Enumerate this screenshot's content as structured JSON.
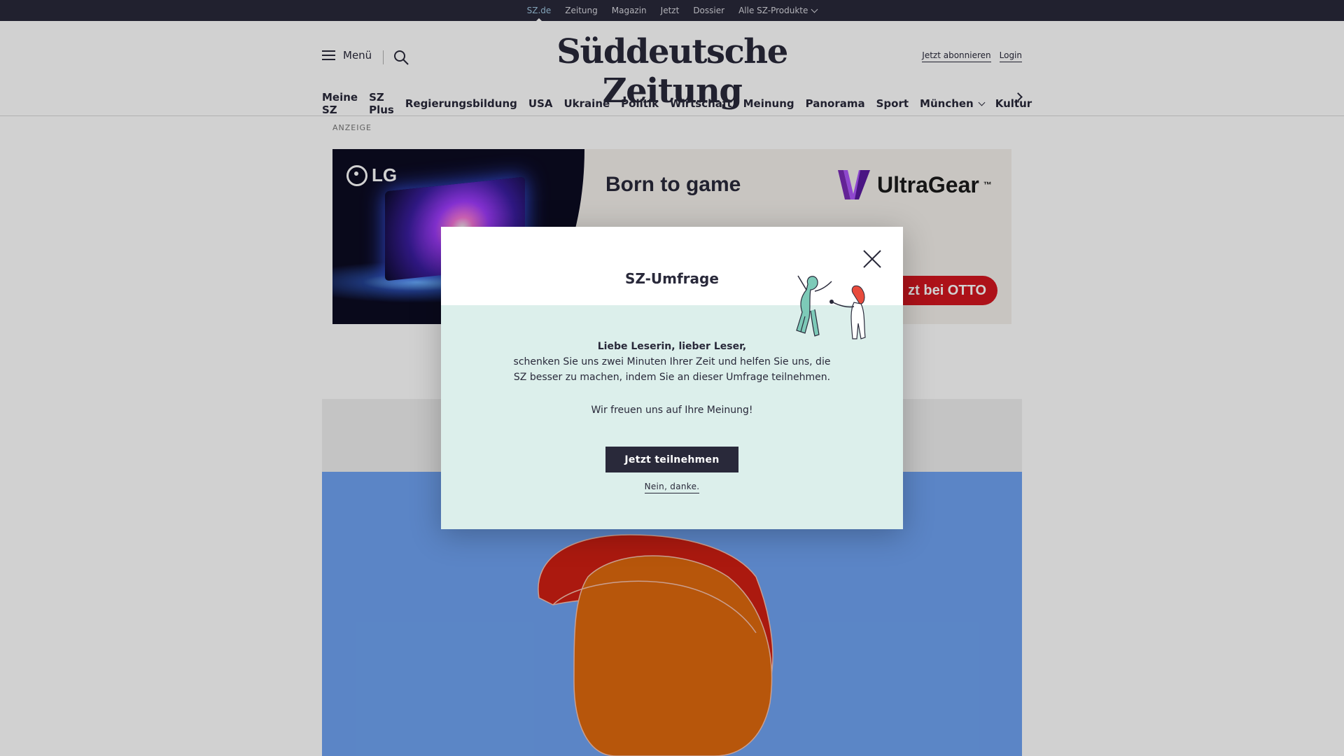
{
  "top_bar": {
    "items": [
      "SZ.de",
      "Zeitung",
      "Magazin",
      "Jetzt",
      "Dossier",
      "Alle SZ-Produkte"
    ]
  },
  "header": {
    "menu_label": "Menü",
    "logo_text": "Süddeutsche Zeitung",
    "subscribe_label": "Jetzt abonnieren",
    "login_label": "Login"
  },
  "ressorts": [
    "Meine SZ",
    "SZ Plus",
    "Regierungsbildung",
    "USA",
    "Ukraine",
    "Politik",
    "Wirtschaft",
    "Meinung",
    "Panorama",
    "Sport",
    "München",
    "Kultur"
  ],
  "ad": {
    "label": "ANZEIGE",
    "brand_logo": "LG",
    "tagline": "Born to game",
    "product_brand": "UltraGear",
    "product_brand_tm": "™",
    "cta": "zt bei OTTO"
  },
  "modal": {
    "title": "SZ-Umfrage",
    "greeting": "Liebe Leserin, lieber Leser,",
    "body": "schenken Sie uns zwei Minuten Ihrer Zeit und helfen Sie uns, die SZ besser zu machen, indem Sie an dieser Umfrage teilnehmen.",
    "thanks": "Wir freuen uns auf Ihre Meinung!",
    "primary_button": "Jetzt teilnehmen",
    "secondary_link": "Nein, danke."
  },
  "colors": {
    "brand_dark": "#29293a",
    "modal_background": "#dcefeb",
    "hero_background": "#6fa3f2",
    "ad_cta_red": "#d4151f"
  }
}
